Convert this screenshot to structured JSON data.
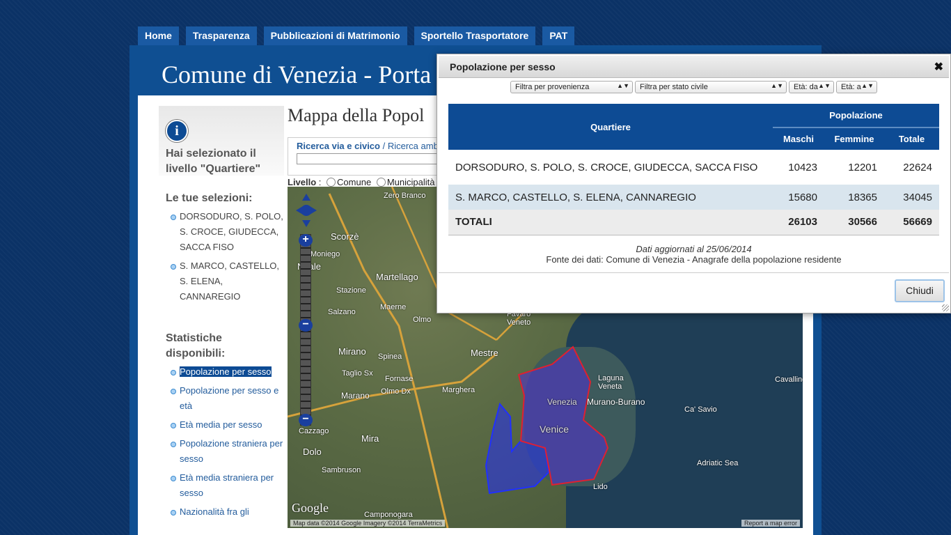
{
  "nav": {
    "tabs": [
      {
        "label": "Home"
      },
      {
        "label": "Trasparenza"
      },
      {
        "label": "Pubblicazioni di Matrimonio"
      },
      {
        "label": "Sportello Trasportatore"
      },
      {
        "label": "PAT"
      }
    ]
  },
  "site": {
    "title": "Comune di Venezia - Porta"
  },
  "sidebar": {
    "selected_level": "Hai selezionato il livello \"Quartiere\"",
    "selections_heading": "Le tue selezioni:",
    "selections": [
      {
        "label": "DORSODURO, S. POLO, S. CROCE, GIUDECCA, SACCA FISO"
      },
      {
        "label": "S. MARCO, CASTELLO, S. ELENA, CANNAREGIO"
      }
    ],
    "stats_heading": "Statistiche disponibili:",
    "stats": [
      {
        "label": "Popolazione per sesso"
      },
      {
        "label": "Popolazione per sesso e età"
      },
      {
        "label": "Età media per sesso"
      },
      {
        "label": "Popolazione straniera per sesso"
      },
      {
        "label": "Età media straniera per sesso"
      },
      {
        "label": "Nazionalità fra gli"
      }
    ]
  },
  "main": {
    "title": "Mappa della Popol",
    "search_tab_active": "Ricerca via e civico",
    "search_tab_separator": " / ",
    "search_tab_other": "Ricerca amb",
    "levels_label": "Livello",
    "levels_colon": " :",
    "levels": [
      {
        "label": "Comune"
      },
      {
        "label": "Municipalità"
      }
    ]
  },
  "map": {
    "labels": [
      {
        "text": "Zero Branco"
      },
      {
        "text": "Scorzè"
      },
      {
        "text": "Martellago"
      },
      {
        "text": "Noale"
      },
      {
        "text": "Maerne"
      },
      {
        "text": "Olmo"
      },
      {
        "text": "Salzano"
      },
      {
        "text": "Mirano"
      },
      {
        "text": "Spinea"
      },
      {
        "text": "Mestre"
      },
      {
        "text": "Marghera"
      },
      {
        "text": "Mira"
      },
      {
        "text": "Dolo"
      },
      {
        "text": "Venice"
      },
      {
        "text": "Venezia"
      },
      {
        "text": "Murano-Burano"
      },
      {
        "text": "Laguna Veneta"
      },
      {
        "text": "Lido"
      },
      {
        "text": "Adriatic Sea"
      },
      {
        "text": "Cavallino"
      },
      {
        "text": "Ca' Savio"
      },
      {
        "text": "Favaro Veneto"
      },
      {
        "text": "Cazzago"
      },
      {
        "text": "Sambruson"
      },
      {
        "text": "Camponogara"
      },
      {
        "text": "Taglio Sx"
      },
      {
        "text": "Stazione"
      },
      {
        "text": "Moniego"
      },
      {
        "text": "Fornase"
      },
      {
        "text": "Marano"
      },
      {
        "text": "Olmo Dx"
      }
    ],
    "google": "Google",
    "attribution": "Map data ©2014 Google Imagery ©2014 TerraMetrics",
    "report": "Report a map error"
  },
  "dialog": {
    "title": "Popolazione per sesso",
    "close_glyph": "✖",
    "filters": [
      {
        "label": "Filtra per provenienza"
      },
      {
        "label": "Filtra per stato civile"
      },
      {
        "label": "Età: da"
      },
      {
        "label": "Età: a"
      }
    ],
    "table": {
      "quartiere_header": "Quartiere",
      "popolazione_header": "Popolazione",
      "cols": [
        "Maschi",
        "Femmine",
        "Totale"
      ],
      "rows": [
        {
          "name": "DORSODURO, S. POLO, S. CROCE, GIUDECCA, SACCA FISO",
          "maschi": "10423",
          "femmine": "12201",
          "totale": "22624"
        },
        {
          "name": "S. MARCO, CASTELLO, S. ELENA, CANNAREGIO",
          "maschi": "15680",
          "femmine": "18365",
          "totale": "34045"
        }
      ],
      "totals": {
        "name": "TOTALI",
        "maschi": "26103",
        "femmine": "30566",
        "totale": "56669"
      }
    },
    "updated": "Dati aggiornati al 25/06/2014",
    "source": "Fonte dei dati: Comune di Venezia - Anagrafe della popolazione residente",
    "button": "Chiudi"
  },
  "colors": {
    "nav_tab": "#1a5aa3",
    "header": "#0f4f92",
    "table_header": "#0d4b94",
    "row_alt": "#d9e5ee"
  }
}
